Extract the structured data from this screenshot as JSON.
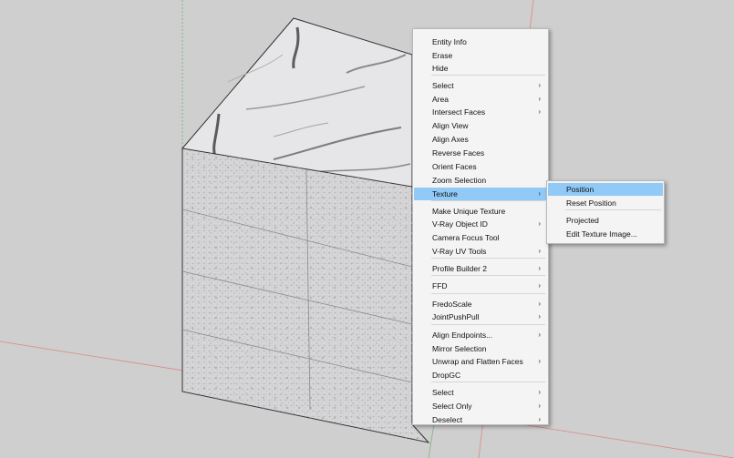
{
  "context_menu": {
    "items": [
      {
        "label": "Entity Info",
        "submenu": false
      },
      {
        "label": "Erase",
        "submenu": false
      },
      {
        "label": "Hide",
        "submenu": false
      },
      {
        "label": "Select",
        "submenu": true
      },
      {
        "label": "Area",
        "submenu": true
      },
      {
        "label": "Intersect Faces",
        "submenu": true
      },
      {
        "label": "Align View",
        "submenu": false
      },
      {
        "label": "Align Axes",
        "submenu": false
      },
      {
        "label": "Reverse Faces",
        "submenu": false
      },
      {
        "label": "Orient Faces",
        "submenu": false
      },
      {
        "label": "Zoom Selection",
        "submenu": false
      },
      {
        "label": "Texture",
        "submenu": true,
        "active": true
      },
      {
        "label": "Make Unique Texture",
        "submenu": false
      },
      {
        "label": "V-Ray Object ID",
        "submenu": true
      },
      {
        "label": "Camera Focus Tool",
        "submenu": false
      },
      {
        "label": "V-Ray UV Tools",
        "submenu": true
      },
      {
        "label": "Profile Builder 2",
        "submenu": true
      },
      {
        "label": "FFD",
        "submenu": true
      },
      {
        "label": "FredoScale",
        "submenu": true
      },
      {
        "label": "JointPushPull",
        "submenu": true
      },
      {
        "label": "Align Endpoints...",
        "submenu": true
      },
      {
        "label": "Mirror Selection",
        "submenu": false
      },
      {
        "label": "Unwrap and Flatten Faces",
        "submenu": true
      },
      {
        "label": "DropGC",
        "submenu": false
      },
      {
        "label": "Select",
        "submenu": true
      },
      {
        "label": "Select Only",
        "submenu": true
      },
      {
        "label": "Deselect",
        "submenu": true
      }
    ]
  },
  "texture_submenu": {
    "items": [
      {
        "label": "Position",
        "active": true
      },
      {
        "label": "Reset Position"
      },
      {
        "label": "Projected"
      },
      {
        "label": "Edit Texture Image..."
      }
    ]
  },
  "arrow_glyph": "›",
  "colors": {
    "background": "#cfcfcf",
    "highlight": "#91c9f7",
    "menu_bg": "#f4f4f4",
    "axis_red": "#c0392b",
    "axis_green": "#3a9b3a"
  }
}
